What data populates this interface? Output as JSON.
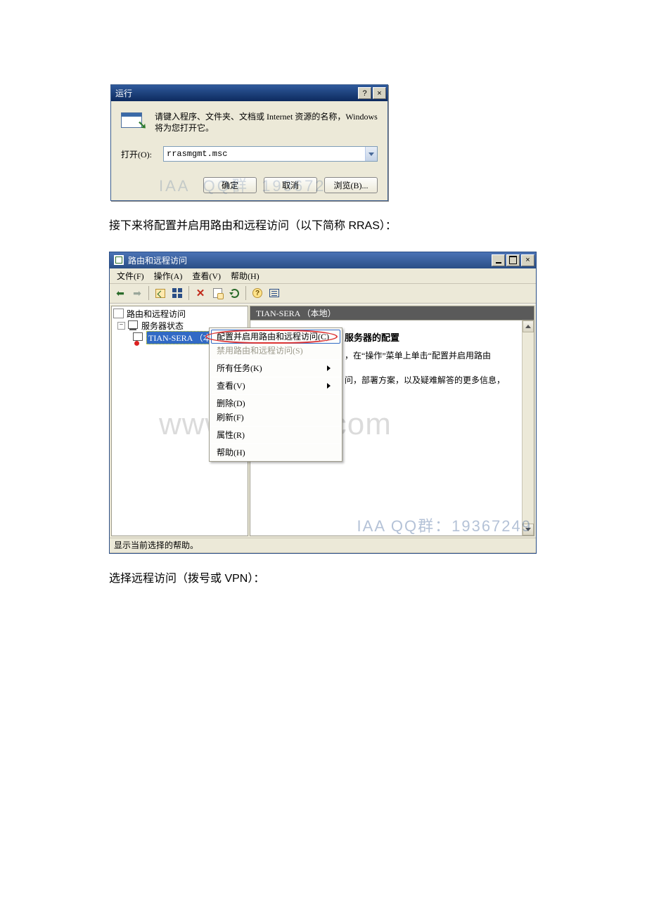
{
  "run_dialog": {
    "title": "运行",
    "desc": "请键入程序、文件夹、文档或 Internet 资源的名称，Windows 将为您打开它。",
    "open_label": "打开(O):",
    "open_value": "rrasmgmt.msc",
    "ok": "确定",
    "cancel": "取消",
    "browse": "浏览(B)...",
    "help_btn": "?",
    "close_btn": "×"
  },
  "caption1": "接下来将配置并启用路由和远程访问（以下简称 RRAS）：",
  "caption2": "选择远程访问（拨号或 VPN）：",
  "mmc": {
    "title": "路由和远程访问",
    "menu": {
      "file": "文件(F)",
      "action": "操作(A)",
      "view": "查看(V)",
      "help": "帮助(H)"
    },
    "tree": {
      "root": "路由和远程访问",
      "status": "服务器状态",
      "server": "TIAN-SERA （本地）"
    },
    "content_header": "TIAN-SERA （本地）",
    "content_title": "服务器的配置",
    "content_line1": "，在“操作”菜单上单击“配置并启用路由",
    "content_line2": "问，部署方案，以及疑难解答的更多信息，",
    "statusbar": "显示当前选择的帮助。",
    "close_btn": "×"
  },
  "context_menu": {
    "configure": "配置并启用路由和远程访问(C)",
    "disable": "禁用路由和远程访问(S)",
    "all_tasks": "所有任务(K)",
    "view": "查看(V)",
    "delete": "删除(D)",
    "refresh": "刷新(F)",
    "properties": "属性(R)",
    "help": "帮助(H)"
  },
  "watermark_big": "www.bdocx.com",
  "watermark_small": "IAA  QQ群：19367249"
}
